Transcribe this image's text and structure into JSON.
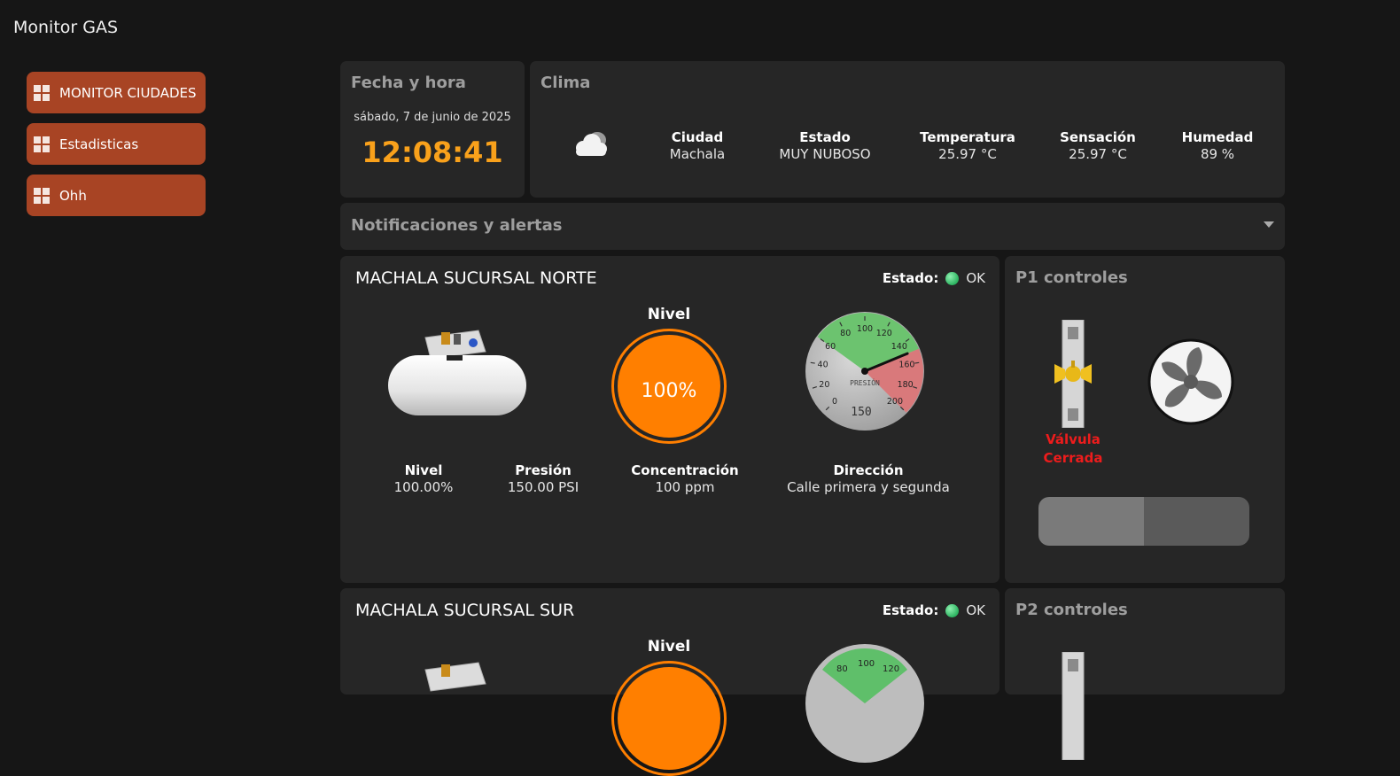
{
  "app": {
    "title": "Monitor GAS"
  },
  "sidebar": {
    "items": [
      {
        "label": "MONITOR CIUDADES"
      },
      {
        "label": "Estadisticas"
      },
      {
        "label": "Ohh"
      }
    ]
  },
  "fecha": {
    "title": "Fecha y hora",
    "date": "sábado, 7 de junio de 2025",
    "time": "12:08:41"
  },
  "clima": {
    "title": "Clima",
    "icon": "cloud-icon",
    "ciudad_h": "Ciudad",
    "ciudad": "Machala",
    "estado_h": "Estado",
    "estado": "MUY NUBOSO",
    "temp_h": "Temperatura",
    "temp": "25.97 °C",
    "sens_h": "Sensación",
    "sens": "25.97 °C",
    "hum_h": "Humedad",
    "hum": "89 %"
  },
  "notificaciones": {
    "title": "Notificaciones y alertas"
  },
  "sites": [
    {
      "name": "MACHALA SUCURSAL NORTE",
      "estado_label": "Estado:",
      "estado": "OK",
      "nivel_title": "Nivel",
      "nivel_pct": "100%",
      "gauge": {
        "label": "PRESIÓN",
        "value": "150",
        "ticks": [
          "0",
          "20",
          "40",
          "60",
          "80",
          "100",
          "120",
          "140",
          "160",
          "180",
          "200"
        ]
      },
      "stats": {
        "nivel_h": "Nivel",
        "nivel": "100.00%",
        "presion_h": "Presión",
        "presion": "150.00 PSI",
        "conc_h": "Concentración",
        "conc": "100 ppm",
        "dir_h": "Dirección",
        "dir": "Calle primera y segunda"
      }
    },
    {
      "name": "MACHALA SUCURSAL SUR",
      "estado_label": "Estado:",
      "estado": "OK",
      "nivel_title": "Nivel",
      "gauge": {
        "ticks": [
          "80",
          "100",
          "120"
        ]
      }
    }
  ],
  "controles": [
    {
      "title": "P1 controles",
      "valve_line1": "Válvula",
      "valve_line2": "Cerrada"
    },
    {
      "title": "P2 controles"
    }
  ],
  "colors": {
    "accent": "#a84424",
    "time": "#f9a11b",
    "nivel": "#ff7f00",
    "ok": "#2cb360",
    "valve_closed": "#ee1c1c"
  }
}
